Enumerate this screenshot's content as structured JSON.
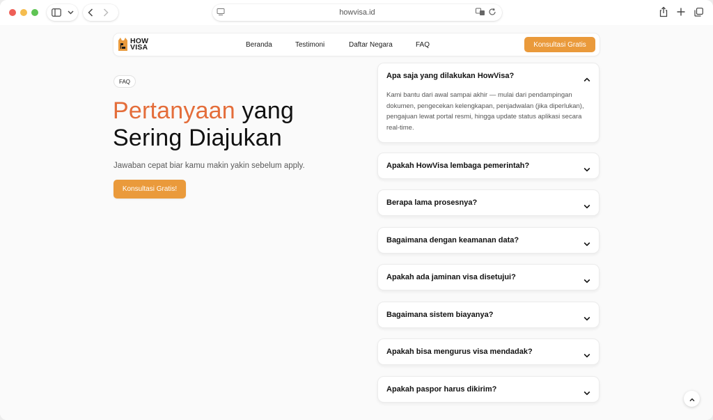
{
  "browser": {
    "url": "howvisa.id"
  },
  "nav": {
    "logo_line1": "HOW",
    "logo_line2": "VISA",
    "links": [
      "Beranda",
      "Testimoni",
      "Daftar Negara",
      "FAQ"
    ],
    "cta": "Konsultasi Gratis"
  },
  "hero": {
    "tag": "FAQ",
    "headline_accent": "Pertanyaan",
    "headline_rest_1": " yang",
    "headline_rest_2": "Sering Diajukan",
    "subtitle": "Jawaban cepat biar kamu makin yakin sebelum apply.",
    "cta": "Konsultasi Gratis!"
  },
  "faq": [
    {
      "question": "Apa saja yang dilakukan HowVisa?",
      "answer": "Kami bantu dari awal sampai akhir — mulai dari pendampingan dokumen, pengecekan kelengkapan, penjadwalan (jika diperlukan), pengajuan lewat portal resmi, hingga update status aplikasi secara real-time.",
      "expanded": true
    },
    {
      "question": "Apakah HowVisa lembaga pemerintah?",
      "expanded": false
    },
    {
      "question": "Berapa lama prosesnya?",
      "expanded": false
    },
    {
      "question": "Bagaimana dengan keamanan data?",
      "expanded": false
    },
    {
      "question": "Apakah ada jaminan visa disetujui?",
      "expanded": false
    },
    {
      "question": "Bagaimana sistem biayanya?",
      "expanded": false
    },
    {
      "question": "Apakah bisa mengurus visa mendadak?",
      "expanded": false
    },
    {
      "question": "Apakah paspor harus dikirim?",
      "expanded": false
    }
  ],
  "colors": {
    "accent_orange": "#ea9a3b",
    "headline_accent": "#e46d3a"
  }
}
